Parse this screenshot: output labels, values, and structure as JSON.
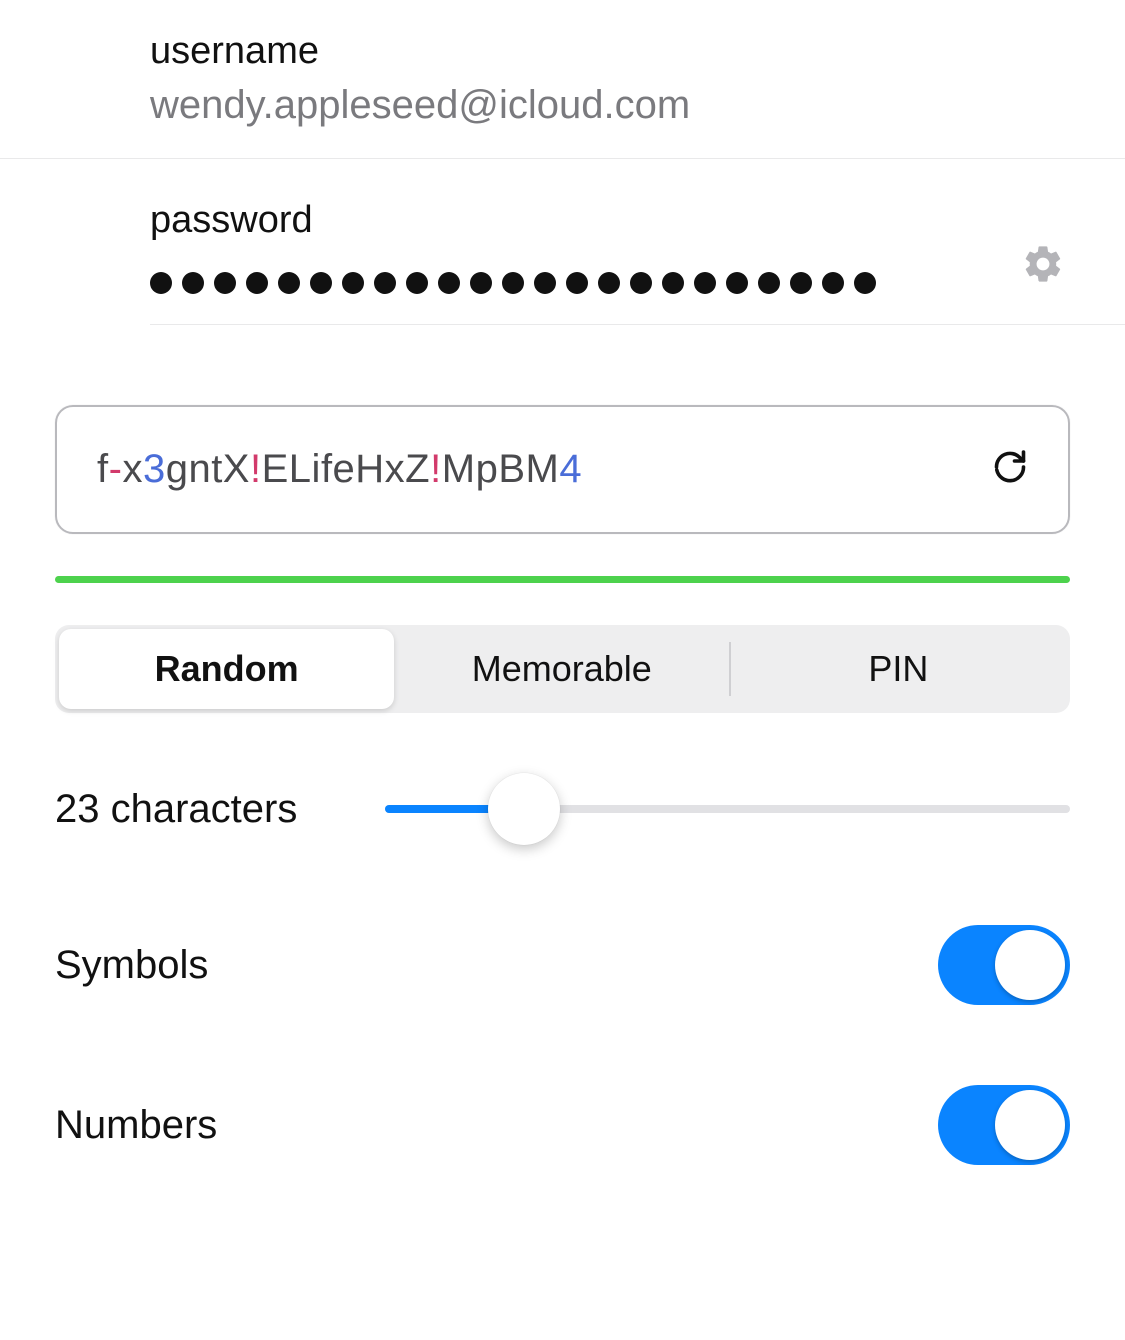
{
  "credentials": {
    "username_label": "username",
    "username_value": "wendy.appleseed@icloud.com",
    "password_label": "password",
    "password_dot_count": 23
  },
  "generator": {
    "tokens": [
      {
        "text": "f",
        "class": "tk-letter"
      },
      {
        "text": "-",
        "class": "tk-symbol"
      },
      {
        "text": "x",
        "class": "tk-letter"
      },
      {
        "text": "3",
        "class": "tk-digit"
      },
      {
        "text": "gntX",
        "class": "tk-letter"
      },
      {
        "text": "!",
        "class": "tk-symbol"
      },
      {
        "text": "ELifeHxZ",
        "class": "tk-letter"
      },
      {
        "text": "!",
        "class": "tk-symbol"
      },
      {
        "text": "MpBM",
        "class": "tk-letter"
      },
      {
        "text": "4",
        "class": "tk-digit"
      }
    ],
    "tabs": {
      "random": "Random",
      "memorable": "Memorable",
      "pin": "PIN"
    },
    "length_label": "23 characters",
    "length_value": 23,
    "slider_fill_percent": 18,
    "symbols_label": "Symbols",
    "symbols_on": true,
    "numbers_label": "Numbers",
    "numbers_on": true,
    "colors": {
      "accent": "#0a84ff",
      "strength": "#4dd24d"
    }
  }
}
